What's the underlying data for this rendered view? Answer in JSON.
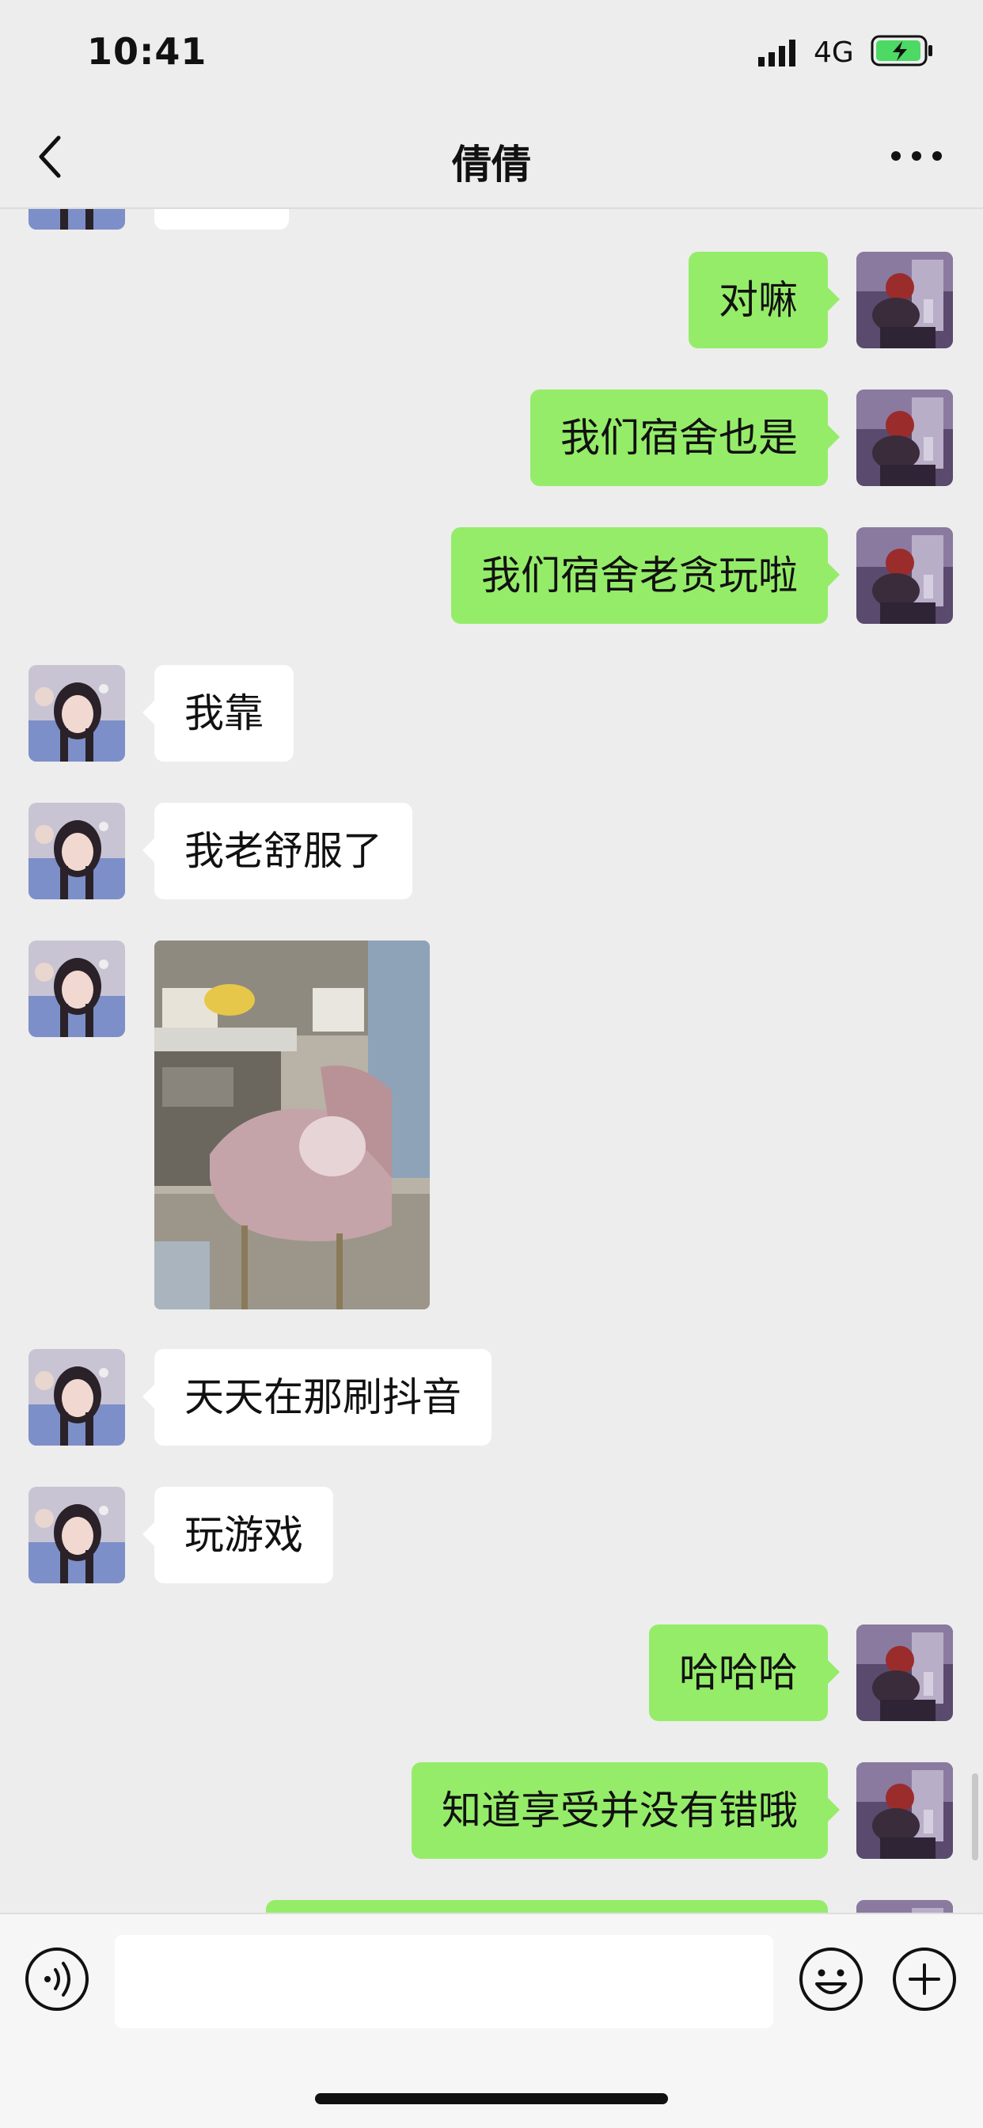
{
  "status_bar": {
    "time": "10:41",
    "network": "4G",
    "battery_charging": true
  },
  "nav": {
    "title": "倩倩",
    "back_icon": "chevron-left-icon",
    "more_icon": "ellipsis-icon"
  },
  "colors": {
    "my_bubble": "#95ec69",
    "their_bubble": "#ffffff",
    "background": "#ededed"
  },
  "messages": [
    {
      "from": "me",
      "text": "对嘛"
    },
    {
      "from": "me",
      "text": "我们宿舍也是"
    },
    {
      "from": "me",
      "text": "我们宿舍老贪玩啦"
    },
    {
      "from": "them",
      "text": "我靠"
    },
    {
      "from": "them",
      "text": "我老舒服了"
    },
    {
      "from": "them",
      "type": "image",
      "icon": "photo-icon"
    },
    {
      "from": "them",
      "text": "天天在那刷抖音"
    },
    {
      "from": "them",
      "text": "玩游戏"
    },
    {
      "from": "me",
      "text": "哈哈哈"
    },
    {
      "from": "me",
      "text": "知道享受并没有错哦"
    }
  ],
  "input_bar": {
    "voice_icon": "voice-icon",
    "text_value": "",
    "emoji_icon": "emoji-icon",
    "plus_icon": "plus-icon"
  }
}
